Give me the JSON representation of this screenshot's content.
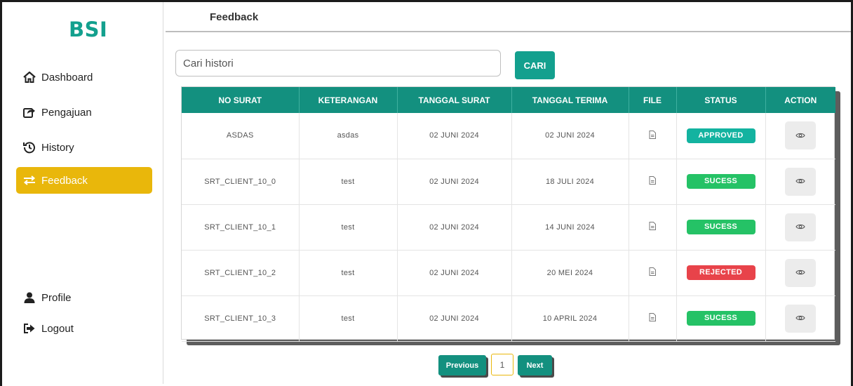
{
  "brand": "BSI",
  "header": {
    "title": "Feedback"
  },
  "sidebar": {
    "items": [
      {
        "label": "Dashboard",
        "icon": "home-icon"
      },
      {
        "label": "Pengajuan",
        "icon": "share-icon"
      },
      {
        "label": "History",
        "icon": "history-icon"
      },
      {
        "label": "Feedback",
        "icon": "exchange-icon",
        "active": true
      }
    ],
    "bottom_items": [
      {
        "label": "Profile",
        "icon": "user-icon"
      },
      {
        "label": "Logout",
        "icon": "logout-icon"
      }
    ]
  },
  "search": {
    "placeholder": "Cari histori",
    "value": "",
    "button_label": "CARI"
  },
  "table": {
    "columns": [
      "NO SURAT",
      "KETERANGAN",
      "TANGGAL SURAT",
      "TANGGAL TERIMA",
      "FILE",
      "STATUS",
      "ACTION"
    ],
    "rows": [
      {
        "no_surat": "ASDAS",
        "keterangan": "asdas",
        "tanggal_surat": "02 JUNI 2024",
        "tanggal_terima": "02 JUNI 2024",
        "status": "APPROVED",
        "status_color": "#13b3a0"
      },
      {
        "no_surat": "SRT_CLIENT_10_0",
        "keterangan": "test",
        "tanggal_surat": "02 JUNI 2024",
        "tanggal_terima": "18 JULI 2024",
        "status": "SUCESS",
        "status_color": "#25c266"
      },
      {
        "no_surat": "SRT_CLIENT_10_1",
        "keterangan": "test",
        "tanggal_surat": "02 JUNI 2024",
        "tanggal_terima": "14 JUNI 2024",
        "status": "SUCESS",
        "status_color": "#25c266"
      },
      {
        "no_surat": "SRT_CLIENT_10_2",
        "keterangan": "test",
        "tanggal_surat": "02 JUNI 2024",
        "tanggal_terima": "20 MEI 2024",
        "status": "REJECTED",
        "status_color": "#e8434a"
      },
      {
        "no_surat": "SRT_CLIENT_10_3",
        "keterangan": "test",
        "tanggal_surat": "02 JUNI 2024",
        "tanggal_terima": "10 APRIL 2024",
        "status": "SUCESS",
        "status_color": "#25c266"
      }
    ]
  },
  "pagination": {
    "previous_label": "Previous",
    "current_page": "1",
    "next_label": "Next"
  },
  "colors": {
    "accent": "#13a08e",
    "active_nav": "#e9b70b",
    "table_header": "#13907f"
  }
}
